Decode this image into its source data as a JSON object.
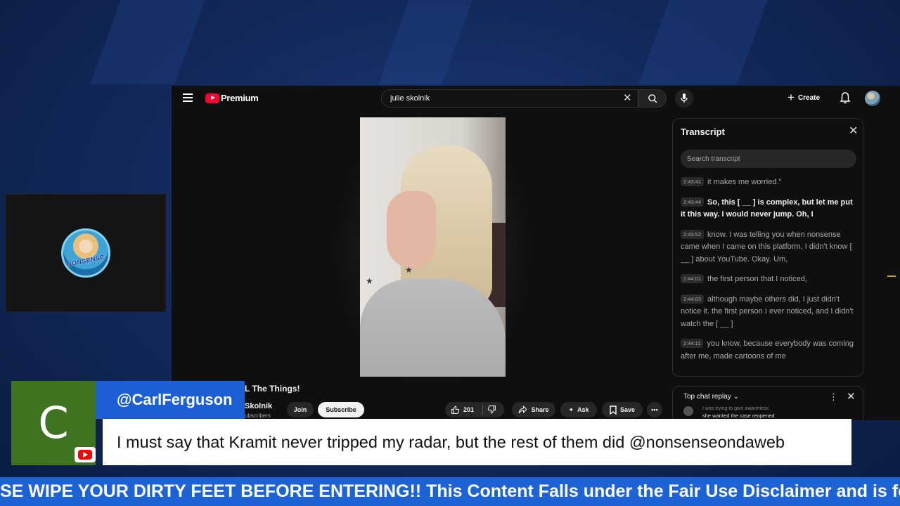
{
  "youtube": {
    "logo_text": "Premium",
    "search_value": "julie skolnik",
    "create_label": "Create",
    "video": {
      "title": "L The Things!",
      "channel_name": "Skolnik",
      "subscribers": "subscribers",
      "join_label": "Join",
      "subscribe_label": "Subscribe",
      "like_count": "201",
      "share_label": "Share",
      "ask_label": "Ask",
      "save_label": "Save"
    },
    "transcript": {
      "title": "Transcript",
      "search_placeholder": "Search transcript",
      "segments": [
        {
          "time": "2:43:41",
          "text": "it makes me worried.\"",
          "active": false
        },
        {
          "time": "2:43:44",
          "text": "So, this [ __ ] is complex, but let me put it this way. I would never jump. Oh, I",
          "active": true
        },
        {
          "time": "2:43:52",
          "text": "know. I was telling you when nonsense came when I came on this platform, I didn't know [ __ ] about YouTube. Okay. Um,",
          "active": false
        },
        {
          "time": "2:44:01",
          "text": "the first person that I noticed,",
          "active": false
        },
        {
          "time": "2:44:03",
          "text": "although maybe others did, I just didn't notice it. the first person I ever noticed, and I didn't watch the [ __ ]",
          "active": false
        },
        {
          "time": "2:44:11",
          "text": "you know, because everybody was coming after me, made cartoons of me",
          "active": false
        }
      ]
    },
    "chat": {
      "title": "Top chat replay",
      "message_partial": "I was trying to gain awareness",
      "message_line2": "she wanted the case reopened"
    }
  },
  "webcam": {
    "logo_text": "NONSENSE"
  },
  "comment_overlay": {
    "avatar_letter": "C",
    "username": "@CarlFerguson",
    "text": "I must say that Kramit never tripped my radar, but the rest of them did @nonsenseondaweb"
  },
  "ticker": {
    "text": "SE WIPE YOUR DIRTY FEET BEFORE ENTERING!! This Content Falls under the Fair Use Disclaimer and is fo"
  },
  "colors": {
    "background": "#132a5c",
    "youtube_bg": "#0f0f0f",
    "youtube_red": "#ff0033",
    "overlay_blue": "#1c5fd4",
    "avatar_green": "#3e7320",
    "ticker_blue": "#1e63d6"
  },
  "icons": [
    "hamburger-menu-icon",
    "youtube-logo-icon",
    "clear-icon",
    "search-icon",
    "microphone-icon",
    "plus-icon",
    "bell-icon",
    "like-icon",
    "dislike-icon",
    "share-icon",
    "ask-sparkle-icon",
    "save-icon",
    "more-icon",
    "close-icon",
    "chevron-down-icon",
    "youtube-badge-icon"
  ]
}
